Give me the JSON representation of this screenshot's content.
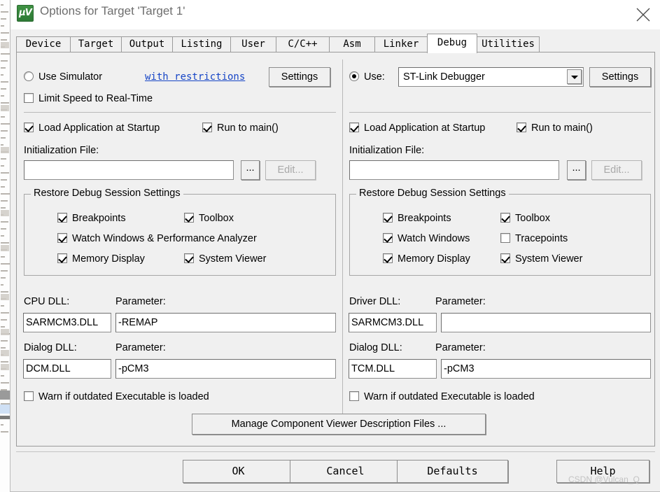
{
  "window": {
    "title": "Options for Target 'Target 1'",
    "icon": "uvision-icon",
    "close_label": "close-icon"
  },
  "tabs": [
    {
      "label": "Device",
      "selected": false
    },
    {
      "label": "Target",
      "selected": false
    },
    {
      "label": "Output",
      "selected": false
    },
    {
      "label": "Listing",
      "selected": false
    },
    {
      "label": "User",
      "selected": false
    },
    {
      "label": "C/C++",
      "selected": false
    },
    {
      "label": "Asm",
      "selected": false
    },
    {
      "label": "Linker",
      "selected": false
    },
    {
      "label": "Debug",
      "selected": true
    },
    {
      "label": "Utilities",
      "selected": false
    }
  ],
  "simulator_panel": {
    "use_simulator_label": "Use Simulator",
    "use_simulator_checked": false,
    "restrictions_link": "with restrictions",
    "settings_button": "Settings",
    "limit_speed_label": "Limit Speed to Real-Time",
    "limit_speed_checked": false,
    "load_app_label": "Load Application at Startup",
    "load_app_checked": true,
    "run_to_main_label": "Run to main()",
    "run_to_main_checked": true,
    "init_file_label": "Initialization File:",
    "init_file_value": "",
    "browse_button": "...",
    "edit_button": "Edit...",
    "edit_enabled": false,
    "restore_group_caption": "Restore Debug Session Settings",
    "restore_items": [
      {
        "label": "Breakpoints",
        "checked": true
      },
      {
        "label": "Toolbox",
        "checked": true
      },
      {
        "label": "Watch Windows & Performance Analyzer",
        "checked": true
      },
      {
        "label": "Memory Display",
        "checked": true
      },
      {
        "label": "System Viewer",
        "checked": true
      }
    ],
    "cpu_dll_label": "CPU DLL:",
    "cpu_dll_value": "SARMCM3.DLL",
    "cpu_param_label": "Parameter:",
    "cpu_param_value": "-REMAP",
    "dialog_dll_label": "Dialog DLL:",
    "dialog_dll_value": "DCM.DLL",
    "dialog_param_label": "Parameter:",
    "dialog_param_value": "-pCM3",
    "warn_outdated_label": "Warn if outdated Executable is loaded",
    "warn_outdated_checked": false
  },
  "debugger_panel": {
    "use_label": "Use:",
    "use_checked": true,
    "debugger_selected": "ST-Link Debugger",
    "settings_button": "Settings",
    "load_app_label": "Load Application at Startup",
    "load_app_checked": true,
    "run_to_main_label": "Run to main()",
    "run_to_main_checked": true,
    "init_file_label": "Initialization File:",
    "init_file_value": "",
    "browse_button": "...",
    "edit_button": "Edit...",
    "edit_enabled": false,
    "restore_group_caption": "Restore Debug Session Settings",
    "restore_items": [
      {
        "label": "Breakpoints",
        "checked": true
      },
      {
        "label": "Toolbox",
        "checked": true
      },
      {
        "label": "Watch Windows",
        "checked": true
      },
      {
        "label": "Tracepoints",
        "checked": false
      },
      {
        "label": "Memory Display",
        "checked": true
      },
      {
        "label": "System Viewer",
        "checked": true
      }
    ],
    "driver_dll_label": "Driver DLL:",
    "driver_dll_value": "SARMCM3.DLL",
    "driver_param_label": "Parameter:",
    "driver_param_value": "",
    "dialog_dll_label": "Dialog DLL:",
    "dialog_dll_value": "TCM.DLL",
    "dialog_param_label": "Parameter:",
    "dialog_param_value": "-pCM3",
    "warn_outdated_label": "Warn if outdated Executable is loaded",
    "warn_outdated_checked": false
  },
  "manage_button": "Manage Component Viewer Description Files ...",
  "footer_buttons": {
    "ok": "OK",
    "cancel": "Cancel",
    "defaults": "Defaults",
    "help": "Help"
  },
  "watermark": "CSDN @Vulcan_Q",
  "colors": {
    "dialog_bg": "#f0f0f0",
    "link": "#1645c6",
    "icon_green": "#3f9243",
    "title_text": "#6e6e6e"
  }
}
